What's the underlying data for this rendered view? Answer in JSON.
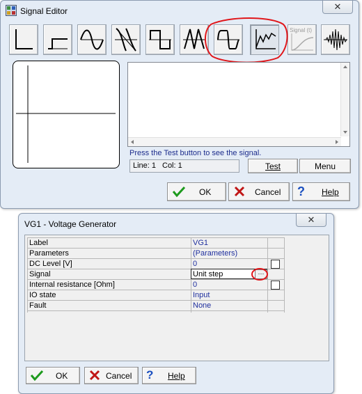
{
  "signal_editor": {
    "title": "Signal Editor",
    "close_symbol": "✕",
    "wave_buttons": [
      {
        "name": "impulse"
      },
      {
        "name": "step"
      },
      {
        "name": "sine"
      },
      {
        "name": "inverse-sine"
      },
      {
        "name": "square"
      },
      {
        "name": "triangle"
      },
      {
        "name": "square-wave"
      },
      {
        "name": "ramp-noise"
      },
      {
        "name": "custom-signal",
        "label": "Signal (t)"
      },
      {
        "name": "burst"
      }
    ],
    "status_text": "Press the Test button to see the signal.",
    "line_label": "Line: 1",
    "col_label": "Col: 1",
    "test_label": "Test",
    "menu_label": "Menu",
    "ok_label": "OK",
    "cancel_label": "Cancel",
    "help_label": "Help"
  },
  "voltage_generator": {
    "title": "VG1 - Voltage Generator",
    "close_symbol": "✕",
    "rows": [
      {
        "label": "Label",
        "value": "VG1",
        "checkbox": false
      },
      {
        "label": "Parameters",
        "value": "(Parameters)",
        "checkbox": false
      },
      {
        "label": "DC Level [V]",
        "value": "0",
        "checkbox": true
      },
      {
        "label": "Signal",
        "value": "Unit step",
        "checkbox": false
      },
      {
        "label": "Internal resistance [Ohm]",
        "value": "0",
        "checkbox": true
      },
      {
        "label": "IO state",
        "value": "Input",
        "checkbox": false
      },
      {
        "label": "Fault",
        "value": "None",
        "checkbox": false
      }
    ],
    "ellipsis_label": "···",
    "ok_label": "OK",
    "cancel_label": "Cancel",
    "help_label": "Help"
  },
  "colors": {
    "annotation_red": "#e0161a",
    "value_blue": "#1f2f9e",
    "status_blue": "#1c2c8c",
    "ok_green": "#1d9a1d",
    "cancel_red": "#c01515",
    "help_blue": "#1a4fc0"
  }
}
